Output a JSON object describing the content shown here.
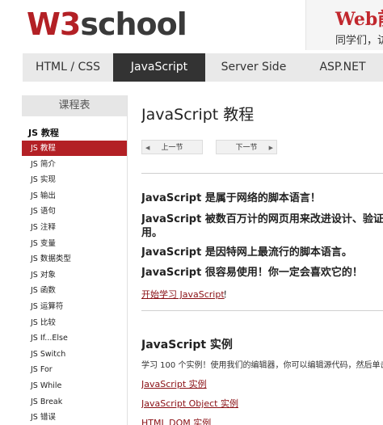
{
  "header": {
    "logo_w3": "W3",
    "logo_school": "school",
    "promo_title": "Web前",
    "promo_sub": "同学们，访"
  },
  "nav": {
    "tabs": [
      "HTML / CSS",
      "JavaScript",
      "Server Side",
      "ASP.NET"
    ],
    "active_tab": "JavaScript"
  },
  "sidebar": {
    "header": "课程表",
    "section": "JS 教程",
    "items": [
      "JS 教程",
      "JS 简介",
      "JS 实现",
      "JS 输出",
      "JS 语句",
      "JS 注释",
      "JS 变量",
      "JS 数据类型",
      "JS 对象",
      "JS 函数",
      "JS 运算符",
      "JS 比较",
      "JS If...Else",
      "JS Switch",
      "JS For",
      "JS While",
      "JS Break",
      "JS 错误"
    ],
    "active_item": "JS 教程"
  },
  "main": {
    "title": "JavaScript 教程",
    "prev_label": "上一节",
    "next_label": "下一节",
    "leads": [
      "JavaScript 是属于网络的脚本语言！",
      "JavaScript 被数百万计的网页用来改进设计、验证表单",
      "用。",
      "JavaScript 是因特网上最流行的脚本语言。",
      "JavaScript 很容易使用！你一定会喜欢它的！"
    ],
    "start_link": "开始学习 JavaScript",
    "start_suffix": "！",
    "examples_title": "JavaScript 实例",
    "examples_desc": "学习 100 个实例！使用我们的编辑器，你可以编辑源代码，然后单击",
    "example_links": [
      "JavaScript 实例",
      "JavaScript Object 实例",
      "HTML DOM 实例"
    ]
  },
  "colors": {
    "brand_red": "#b32025",
    "dark_tab": "#333333",
    "link_red": "#8a0f14"
  }
}
